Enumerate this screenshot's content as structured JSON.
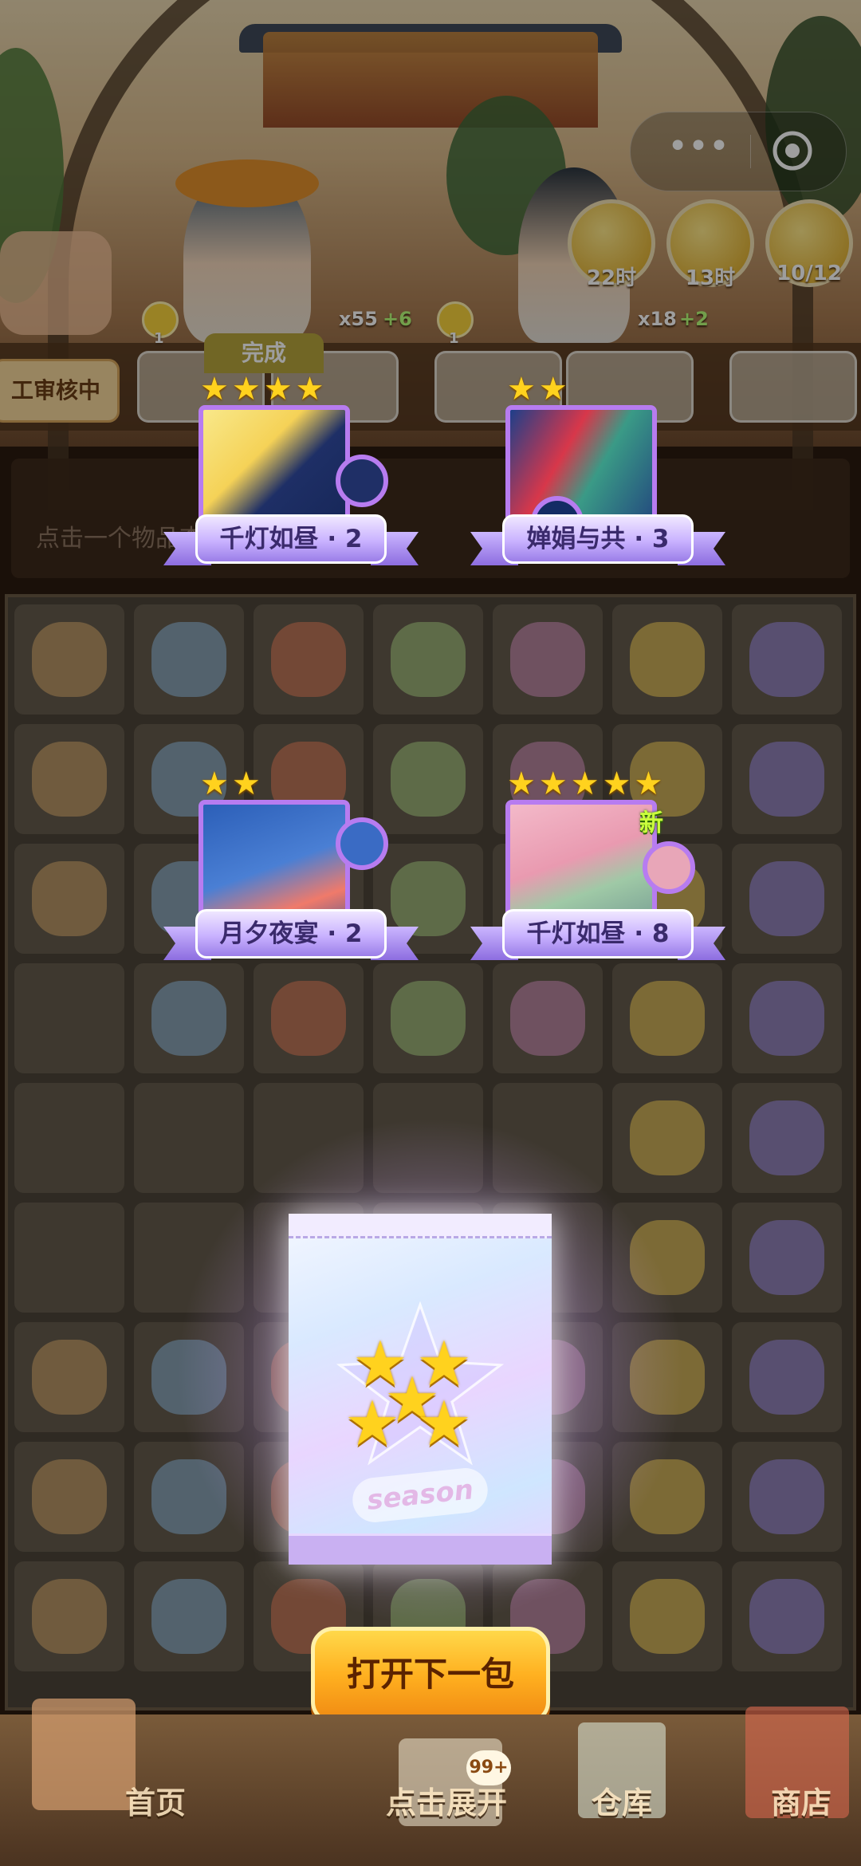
{
  "top": {
    "menu_dots": "•••",
    "timers": [
      {
        "icon": "clover-icon",
        "label": "22时"
      },
      {
        "icon": "teapot-icon",
        "label": "13时"
      },
      {
        "icon": "sunflower-icon",
        "label": "10/12"
      }
    ],
    "customers": [
      {
        "level": "1",
        "reward": "x55",
        "bonus": "+6"
      },
      {
        "level": "1",
        "reward": "x18",
        "bonus": "+2"
      }
    ],
    "review_label": "工审核中",
    "done_label": "完成",
    "hint_text": "点击一个物品查看信息"
  },
  "cards": [
    {
      "stars": 4,
      "name": "千灯如昼 · 2",
      "is_new": false
    },
    {
      "stars": 2,
      "name": "婵娟与共 · 3",
      "is_new": false
    },
    {
      "stars": 2,
      "name": "月夕夜宴 · 2",
      "is_new": false
    },
    {
      "stars": 5,
      "name": "千灯如昼 · 8",
      "is_new": true
    }
  ],
  "new_badge": "新",
  "pack": {
    "stars": 5,
    "label": "season"
  },
  "open_button": "打开下一包",
  "nav": {
    "home": "首页",
    "expand": "点击展开",
    "expand_badge": "99+",
    "warehouse": "仓库",
    "shop": "商店"
  },
  "colors": {
    "accent_purple": "#b77cf0",
    "star_gold": "#ffd21e",
    "button_orange": "#ffb020"
  }
}
